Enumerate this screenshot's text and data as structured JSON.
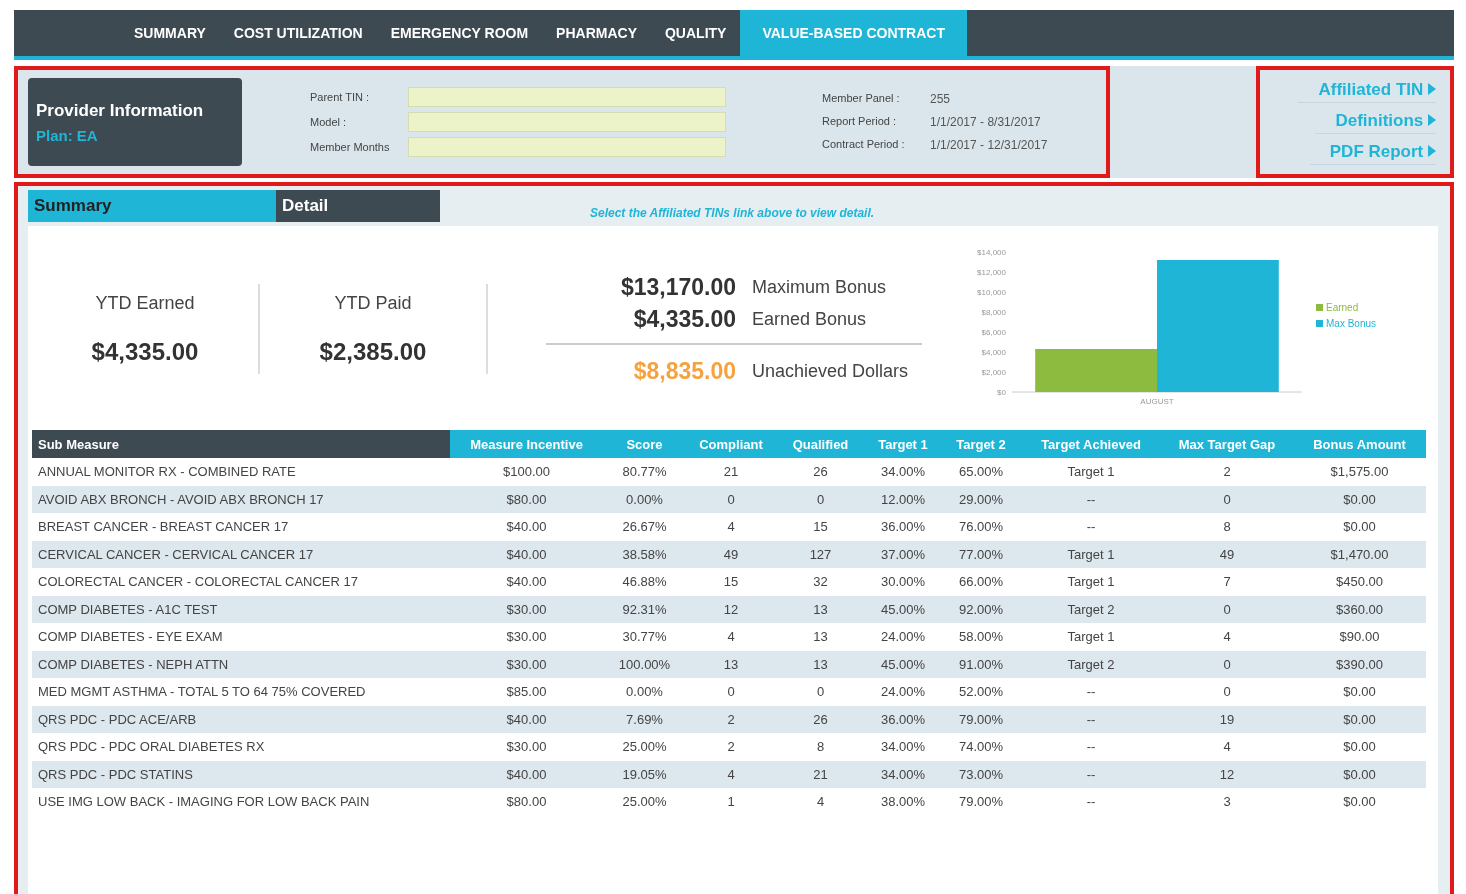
{
  "nav_tabs": [
    {
      "label": "SUMMARY",
      "selected": false
    },
    {
      "label": "COST UTILIZATION",
      "selected": false
    },
    {
      "label": "EMERGENCY ROOM",
      "selected": false
    },
    {
      "label": "PHARMACY",
      "selected": false
    },
    {
      "label": "QUALITY",
      "selected": false
    },
    {
      "label": "VALUE-BASED CONTRACT",
      "selected": true
    }
  ],
  "provider": {
    "title": "Provider Information",
    "plan": "Plan: EA",
    "fields": [
      {
        "label": "Parent TIN :"
      },
      {
        "label": "Model :"
      },
      {
        "label": "Member Months"
      }
    ],
    "details": [
      {
        "label": "Member Panel :",
        "value": "255"
      },
      {
        "label": "Report Period :",
        "value": "1/1/2017 - 8/31/2017"
      },
      {
        "label": "Contract Period :",
        "value": "1/1/2017 - 12/31/2017"
      }
    ]
  },
  "links": [
    "Affiliated TIN",
    "Definitions",
    "PDF Report"
  ],
  "view_tabs": [
    {
      "label": "Summary",
      "selected": true
    },
    {
      "label": "Detail",
      "selected": false
    }
  ],
  "note": "Select the Affiliated TINs link above to view detail.",
  "ytd": [
    {
      "label": "YTD Earned",
      "value": "$4,335.00"
    },
    {
      "label": "YTD Paid",
      "value": "$2,385.00"
    }
  ],
  "bonus": [
    {
      "value": "$13,170.00",
      "label": "Maximum Bonus",
      "kind": "normal"
    },
    {
      "value": "$4,335.00",
      "label": "Earned Bonus",
      "kind": "normal"
    },
    {
      "value": "$8,835.00",
      "label": "Unachieved Dollars",
      "kind": "highlight"
    }
  ],
  "chart_data": {
    "type": "bar",
    "categories": [
      "AUGUST"
    ],
    "series": [
      {
        "name": "Earned",
        "color": "#8cbb3f",
        "values": [
          4300
        ]
      },
      {
        "name": "Max Bonus",
        "color": "#1fb5d6",
        "values": [
          13200
        ]
      }
    ],
    "legend": true,
    "ylim": [
      0,
      14000
    ],
    "yticks": [
      {
        "value": 0,
        "label": "$0"
      },
      {
        "value": 2000,
        "label": "$2,000"
      },
      {
        "value": 4000,
        "label": "$4,000"
      },
      {
        "value": 6000,
        "label": "$6,000"
      },
      {
        "value": 8000,
        "label": "$8,000"
      },
      {
        "value": 10000,
        "label": "$10,000"
      },
      {
        "value": 12000,
        "label": "$12,000"
      },
      {
        "value": 14000,
        "label": "$14,000"
      }
    ]
  },
  "table": {
    "columns": [
      "Sub Measure",
      "Measure Incentive",
      "Score",
      "Compliant",
      "Qualified",
      "Target 1",
      "Target 2",
      "Target Achieved",
      "Max Target Gap",
      "Bonus Amount"
    ],
    "rows": [
      [
        "ANNUAL MONITOR RX - COMBINED RATE",
        "$100.00",
        "80.77%",
        "21",
        "26",
        "34.00%",
        "65.00%",
        "Target 1",
        "2",
        "$1,575.00"
      ],
      [
        "AVOID ABX BRONCH - AVOID ABX BRONCH 17",
        "$80.00",
        "0.00%",
        "0",
        "0",
        "12.00%",
        "29.00%",
        "--",
        "0",
        "$0.00"
      ],
      [
        "BREAST CANCER - BREAST CANCER 17",
        "$40.00",
        "26.67%",
        "4",
        "15",
        "36.00%",
        "76.00%",
        "--",
        "8",
        "$0.00"
      ],
      [
        "CERVICAL CANCER - CERVICAL CANCER 17",
        "$40.00",
        "38.58%",
        "49",
        "127",
        "37.00%",
        "77.00%",
        "Target 1",
        "49",
        "$1,470.00"
      ],
      [
        "COLORECTAL CANCER - COLORECTAL CANCER 17",
        "$40.00",
        "46.88%",
        "15",
        "32",
        "30.00%",
        "66.00%",
        "Target 1",
        "7",
        "$450.00"
      ],
      [
        "COMP DIABETES - A1C TEST",
        "$30.00",
        "92.31%",
        "12",
        "13",
        "45.00%",
        "92.00%",
        "Target 2",
        "0",
        "$360.00"
      ],
      [
        "COMP DIABETES - EYE EXAM",
        "$30.00",
        "30.77%",
        "4",
        "13",
        "24.00%",
        "58.00%",
        "Target 1",
        "4",
        "$90.00"
      ],
      [
        "COMP DIABETES - NEPH ATTN",
        "$30.00",
        "100.00%",
        "13",
        "13",
        "45.00%",
        "91.00%",
        "Target 2",
        "0",
        "$390.00"
      ],
      [
        "MED MGMT ASTHMA - TOTAL 5 TO 64 75% COVERED",
        "$85.00",
        "0.00%",
        "0",
        "0",
        "24.00%",
        "52.00%",
        "--",
        "0",
        "$0.00"
      ],
      [
        "QRS PDC - PDC ACE/ARB",
        "$40.00",
        "7.69%",
        "2",
        "26",
        "36.00%",
        "79.00%",
        "--",
        "19",
        "$0.00"
      ],
      [
        "QRS PDC - PDC ORAL DIABETES RX",
        "$30.00",
        "25.00%",
        "2",
        "8",
        "34.00%",
        "74.00%",
        "--",
        "4",
        "$0.00"
      ],
      [
        "QRS PDC - PDC STATINS",
        "$40.00",
        "19.05%",
        "4",
        "21",
        "34.00%",
        "73.00%",
        "--",
        "12",
        "$0.00"
      ],
      [
        "USE IMG LOW BACK - IMAGING FOR LOW BACK PAIN",
        "$80.00",
        "25.00%",
        "1",
        "4",
        "38.00%",
        "79.00%",
        "--",
        "3",
        "$0.00"
      ]
    ]
  }
}
